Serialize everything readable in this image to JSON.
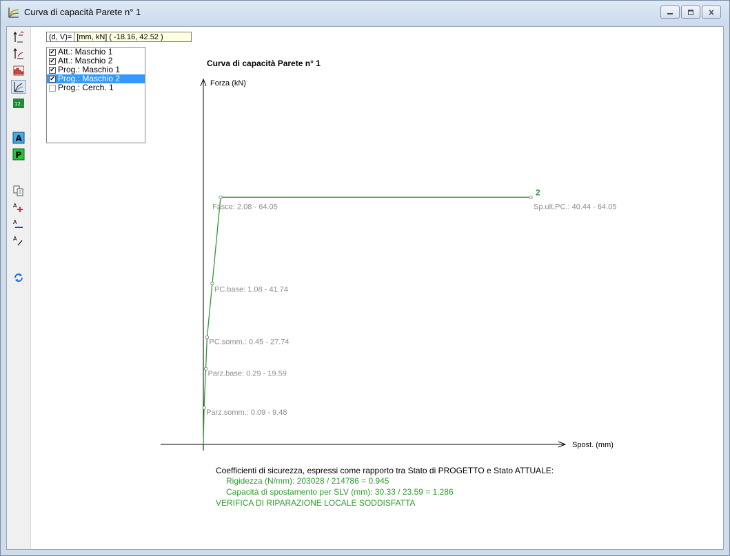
{
  "window": {
    "title": "Curva di capacità Parete n° 1",
    "buttons": [
      "minimize",
      "maximize",
      "close"
    ]
  },
  "toolbar": {
    "tools": [
      "curve-axis-icon",
      "curve-edit-icon",
      "histogram-icon",
      "graph-icon",
      "numeric-12-icon",
      "letter-a-icon",
      "letter-p-icon",
      "copy-icon",
      "font-increase-icon",
      "font-decrease-icon",
      "font-italic-icon",
      "refresh-icon"
    ],
    "label_12": "12..",
    "label_a": "A",
    "label_p": "P",
    "label_font": "A"
  },
  "coords": {
    "label": "(d, V)=",
    "value": "[mm, kN]  ( -18.16, 42.52 )"
  },
  "layers": [
    {
      "label": "Att.: Maschio 1",
      "checked": true,
      "selected": false
    },
    {
      "label": "Att.: Maschio 2",
      "checked": true,
      "selected": false
    },
    {
      "label": "Prog.: Maschio 1",
      "checked": true,
      "selected": false
    },
    {
      "label": "Prog.: Maschio 2",
      "checked": true,
      "selected": true
    },
    {
      "label": "Prog.: Cerch. 1",
      "checked": false,
      "selected": false
    }
  ],
  "chart_data": {
    "type": "line",
    "title": "Curva di capacità Parete n° 1",
    "ylabel": "Forza (kN)",
    "xlabel": "Spost. (mm)",
    "series": [
      {
        "name": "2",
        "color": "#2e9c2e",
        "x": [
          0,
          0.09,
          0.29,
          0.45,
          1.08,
          2.08,
          40.44
        ],
        "y": [
          0,
          9.48,
          19.59,
          27.74,
          41.74,
          64.05,
          64.05
        ]
      }
    ],
    "point_labels": [
      "Parz.somm.: 0.09 - 9.48",
      "Parz.base: 0.29 - 19.59",
      "PC.somm.: 0.45 - 27.74",
      "PC.base: 1.08 - 41.74",
      "Fasce: 2.08 - 64.05",
      "Sp.ult.PC.: 40.44 - 64.05"
    ],
    "grid": false,
    "label_color": "#8c8c8c"
  },
  "footer": {
    "heading": "Coefficienti di sicurezza, espressi come rapporto tra Stato di PROGETTO e Stato ATTUALE:",
    "rigidezza": "Rigidezza (N/mm): 203028 / 214786 = 0.945",
    "capacita": "Capacità di spostamento per SLV (mm): 30.33 / 23.59 = 1.286",
    "verdict": "VERIFICA DI RIPARAZIONE LOCALE SODDISFATTA",
    "heading_color": "#000000",
    "value_color": "#2e9c2e"
  }
}
